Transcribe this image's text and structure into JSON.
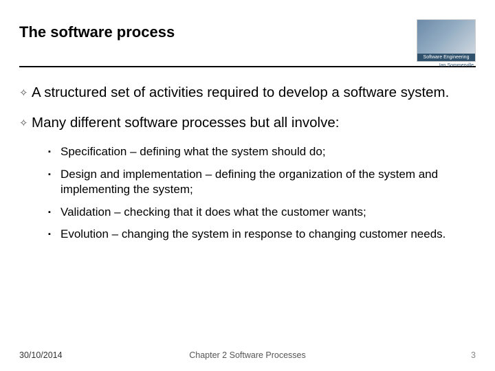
{
  "header": {
    "title": "The software process",
    "logo_band": "Software Engineering",
    "logo_author": "Ian Sommerville"
  },
  "bullets": [
    {
      "text": "A structured set of activities required to develop a software system."
    },
    {
      "text": "Many different software processes but all involve:",
      "sub": [
        "Specification – defining what the system should do;",
        "Design and implementation – defining the organization of the system and implementing the system;",
        "Validation – checking that it does what the customer wants;",
        "Evolution – changing the system in response to changing customer needs."
      ]
    }
  ],
  "footer": {
    "date": "30/10/2014",
    "center": "Chapter 2 Software Processes",
    "page": "3"
  }
}
